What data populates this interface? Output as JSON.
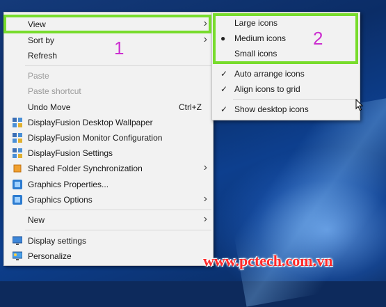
{
  "main_menu": {
    "items": [
      {
        "name": "menu-item-view",
        "label": "View",
        "arrow": "›",
        "enabled": true
      },
      {
        "name": "menu-item-sort-by",
        "label": "Sort by",
        "arrow": "›",
        "enabled": true
      },
      {
        "name": "menu-item-refresh",
        "label": "Refresh",
        "enabled": true
      },
      {
        "name": "menu-item-paste",
        "label": "Paste",
        "enabled": false
      },
      {
        "name": "menu-item-paste-shortcut",
        "label": "Paste shortcut",
        "enabled": false
      },
      {
        "name": "menu-item-undo-move",
        "label": "Undo Move",
        "shortcut": "Ctrl+Z",
        "enabled": true
      },
      {
        "name": "menu-item-displayfusion-wallpaper",
        "label": "DisplayFusion Desktop Wallpaper",
        "icon": "displayfusion-icon",
        "enabled": true
      },
      {
        "name": "menu-item-displayfusion-monitor",
        "label": "DisplayFusion Monitor Configuration",
        "icon": "displayfusion-icon",
        "enabled": true
      },
      {
        "name": "menu-item-displayfusion-settings",
        "label": "DisplayFusion Settings",
        "icon": "displayfusion-icon",
        "enabled": true
      },
      {
        "name": "menu-item-shared-folder-sync",
        "label": "Shared Folder Synchronization",
        "icon": "sync-icon",
        "arrow": "›",
        "enabled": true
      },
      {
        "name": "menu-item-graphics-properties",
        "label": "Graphics Properties...",
        "icon": "graphics-icon",
        "enabled": true
      },
      {
        "name": "menu-item-graphics-options",
        "label": "Graphics Options",
        "icon": "graphics-icon",
        "arrow": "›",
        "enabled": true
      },
      {
        "name": "menu-item-new",
        "label": "New",
        "arrow": "›",
        "enabled": true
      },
      {
        "name": "menu-item-display-settings",
        "label": "Display settings",
        "icon": "display-icon",
        "enabled": true
      },
      {
        "name": "menu-item-personalize",
        "label": "Personalize",
        "icon": "personalize-icon",
        "enabled": true
      }
    ]
  },
  "view_submenu": {
    "items": [
      {
        "name": "submenu-item-large-icons",
        "label": "Large icons",
        "mark": ""
      },
      {
        "name": "submenu-item-medium-icons",
        "label": "Medium icons",
        "mark": "●"
      },
      {
        "name": "submenu-item-small-icons",
        "label": "Small icons",
        "mark": ""
      },
      {
        "name": "submenu-item-auto-arrange",
        "label": "Auto arrange icons",
        "mark": "✓"
      },
      {
        "name": "submenu-item-align-to-grid",
        "label": "Align icons to grid",
        "mark": "✓"
      },
      {
        "name": "submenu-item-show-desktop-icons",
        "label": "Show desktop icons",
        "mark": "✓"
      }
    ]
  },
  "annotations": {
    "step_one": "1",
    "step_two": "2",
    "highlight_color": "#78dc2c",
    "number_color": "#cc2fd0"
  },
  "watermark": "www.pctech.com.vn"
}
